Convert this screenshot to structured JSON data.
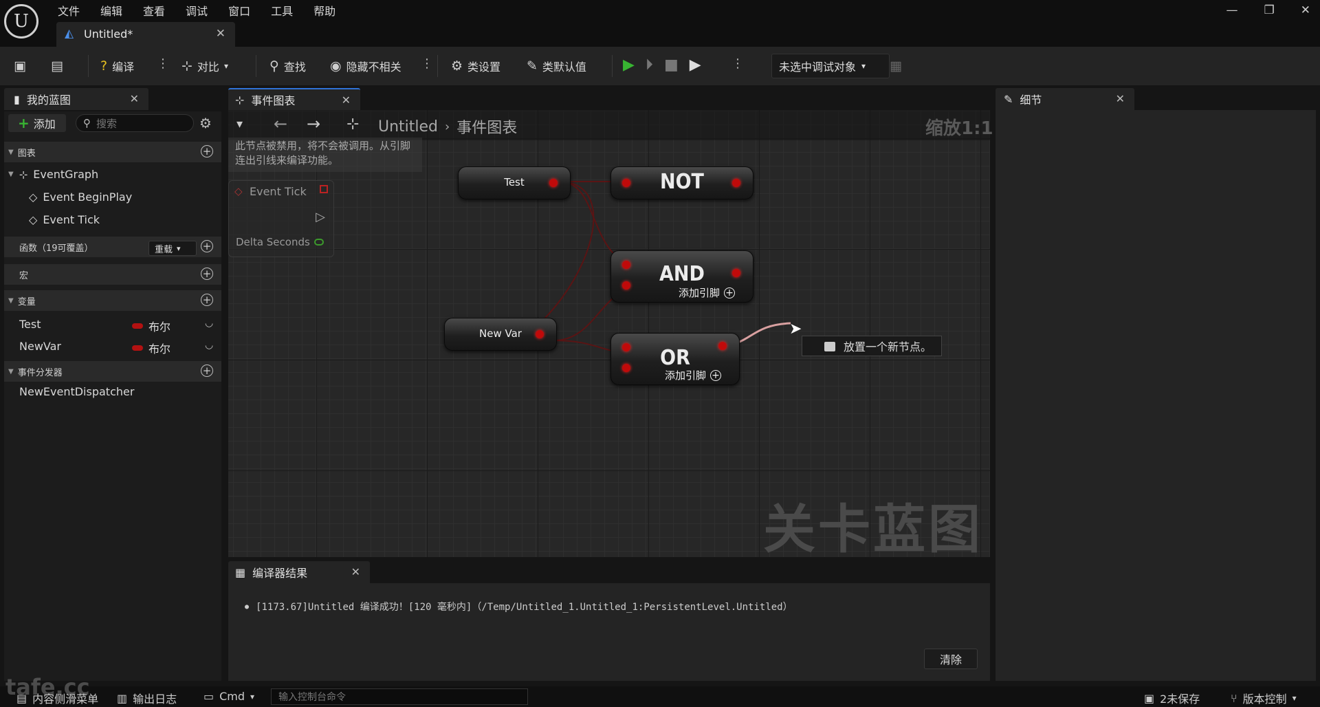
{
  "menu": [
    "文件",
    "编辑",
    "查看",
    "调试",
    "窗口",
    "工具",
    "帮助"
  ],
  "doc_tab": {
    "title": "Untitled*"
  },
  "toolbar": {
    "compile": "编译",
    "diff": "对比",
    "find": "查找",
    "hide_unrelated": "隐藏不相关",
    "class_settings": "类设置",
    "class_defaults": "类默认值",
    "debug_target": "未选中调试对象"
  },
  "my_blueprint": {
    "tab": "我的蓝图",
    "add": "添加",
    "search_placeholder": "搜索",
    "graphs_section": "图表",
    "event_graph": "EventGraph",
    "events": [
      "Event BeginPlay",
      "Event Tick"
    ],
    "functions_section": "函数（19可覆盖）",
    "override": "重载",
    "macros_section": "宏",
    "variables_section": "变量",
    "variables": [
      {
        "name": "Test",
        "type": "布尔"
      },
      {
        "name": "NewVar",
        "type": "布尔"
      }
    ],
    "dispatchers_section": "事件分发器",
    "dispatcher": "NewEventDispatcher"
  },
  "graph": {
    "tab": "事件图表",
    "breadcrumb_root": "Untitled",
    "breadcrumb_current": "事件图表",
    "zoom": "缩放1:1",
    "disabled_note": "此节点被禁用，将不会被调用。从引脚连出引线来编译功能。",
    "watermark": "关卡蓝图",
    "event_tick_node": {
      "title": "Event Tick",
      "pin": "Delta Seconds"
    },
    "nodes": {
      "test": "Test",
      "newvar": "New Var",
      "not": "NOT",
      "and": "AND",
      "or": "OR",
      "add_pin": "添加引脚"
    },
    "place_node": "放置一个新节点。"
  },
  "details": {
    "tab": "细节"
  },
  "compiler": {
    "tab": "编译器结果",
    "log": "[1173.67]Untitled 编译成功！[120 毫秒内]（/Temp/Untitled_1.Untitled_1:PersistentLevel.Untitled）",
    "clear": "清除"
  },
  "statusbar": {
    "content_drawer": "内容侧滑菜单",
    "output_log": "输出日志",
    "cmd": "Cmd",
    "console_placeholder": "输入控制台命令",
    "unsaved": "2未保存",
    "source_control": "版本控制"
  },
  "site_watermark": "tafe.cc",
  "colors": {
    "bool_pin": "#c00a0a",
    "accent": "#2f73d8",
    "play": "#38b432"
  }
}
